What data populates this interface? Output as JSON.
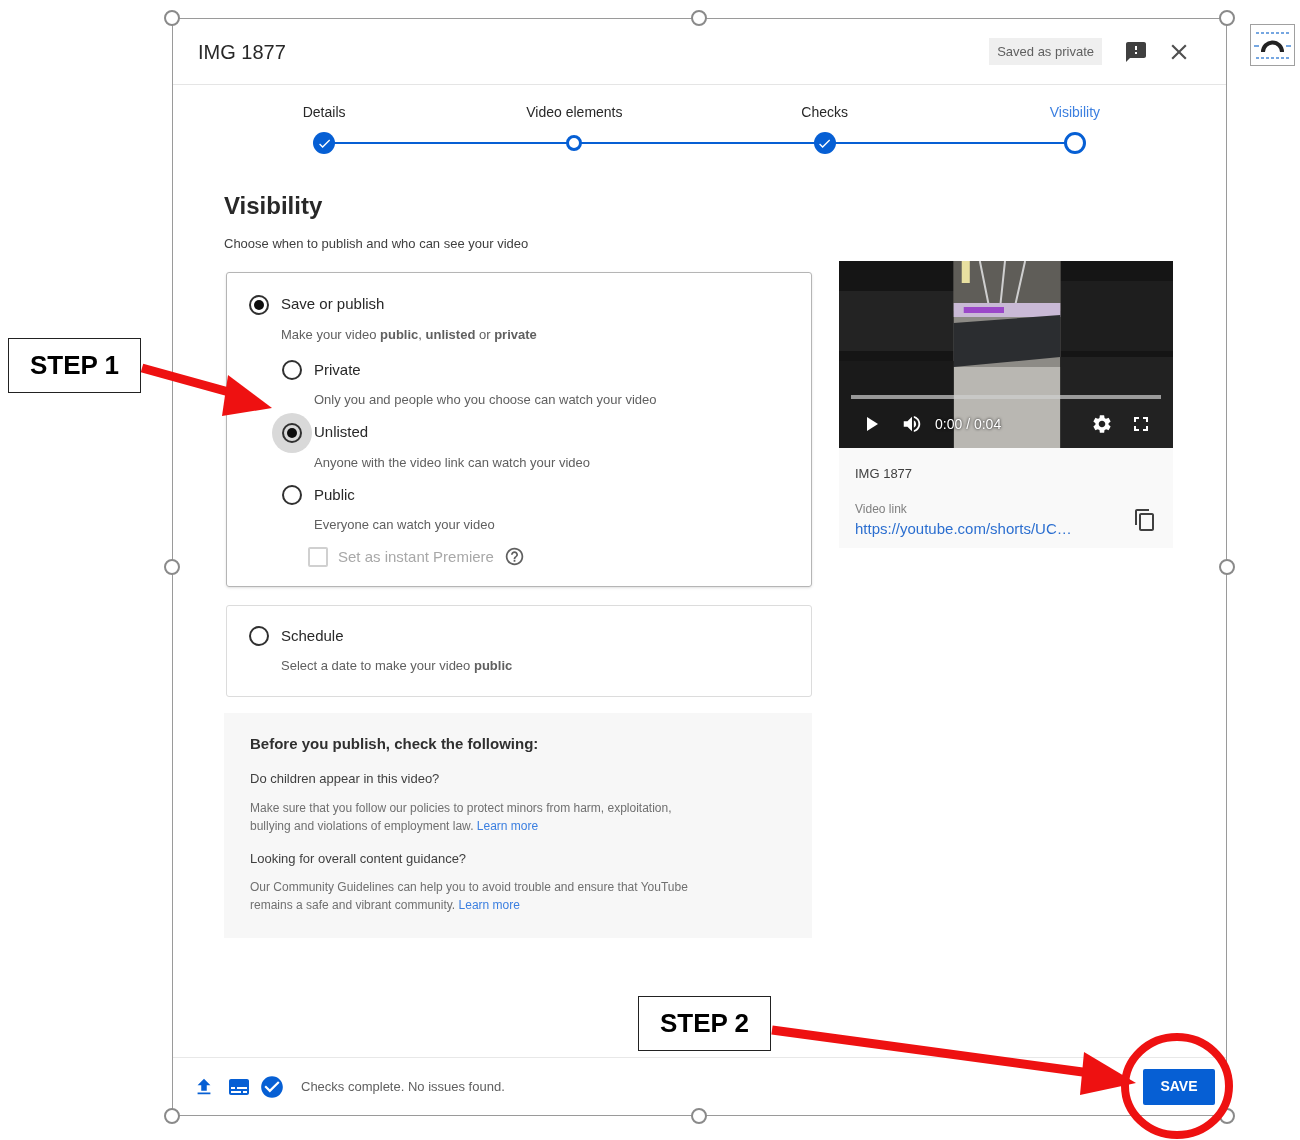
{
  "dialog": {
    "title": "IMG 1877",
    "status_badge": "Saved as private"
  },
  "steps": [
    {
      "label": "Details",
      "done": true,
      "selected": false
    },
    {
      "label": "Video elements",
      "done": false,
      "selected": false
    },
    {
      "label": "Checks",
      "done": true,
      "selected": false
    },
    {
      "label": "Visibility",
      "done": false,
      "selected": true
    }
  ],
  "visibility": {
    "heading": "Visibility",
    "subtitle": "Choose when to publish and who can see your video"
  },
  "save_or_publish": {
    "label": "Save or publish",
    "selected": true,
    "description": "Make your video **public**, **unlisted** or **private**",
    "options": [
      {
        "label": "Private",
        "description": "Only you and people who you choose can watch your video",
        "selected": false,
        "focused": false
      },
      {
        "label": "Unlisted",
        "description": "Anyone with the video link can watch your video",
        "selected": true,
        "focused": true
      },
      {
        "label": "Public",
        "description": "Everyone can watch your video",
        "selected": false,
        "focused": false
      }
    ],
    "premiere": {
      "label": "Set as instant Premiere",
      "checked": false,
      "disabled": true
    }
  },
  "schedule": {
    "label": "Schedule",
    "selected": false,
    "description": "Select a date to make your video **public**"
  },
  "notice": {
    "heading": "Before you publish, check the following:",
    "items": [
      {
        "question": "Do children appear in this video?",
        "text": "Make sure that you follow our policies to protect minors from harm, exploitation, bullying and violations of employment law.",
        "link": "Learn more"
      },
      {
        "question": "Looking for overall content guidance?",
        "text": "Our Community Guidelines can help you to avoid trouble and ensure that YouTube remains a safe and vibrant community.",
        "link": "Learn more"
      }
    ]
  },
  "preview": {
    "time": "0:00 / 0:04",
    "title": "IMG 1877",
    "link_label": "Video link",
    "link": "https://youtube.com/shorts/UC…"
  },
  "footer": {
    "status": "Checks complete. No issues found.",
    "save_button": "SAVE"
  },
  "annotations": [
    {
      "label": "STEP 1"
    },
    {
      "label": "STEP 2"
    }
  ]
}
